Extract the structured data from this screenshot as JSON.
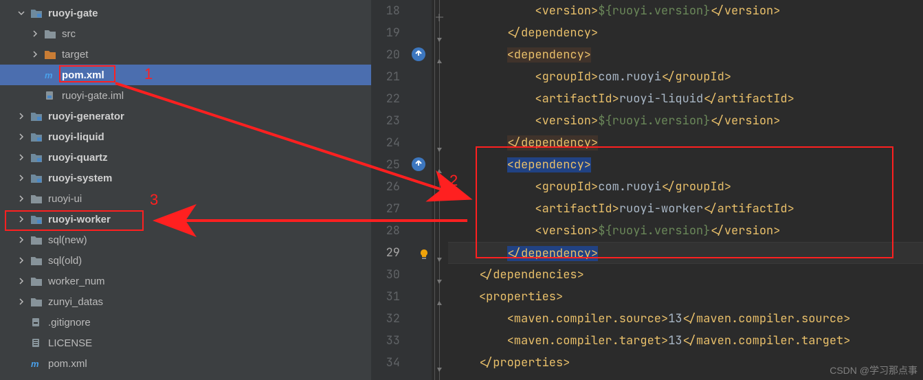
{
  "tree": {
    "ruoyi_gate": "ruoyi-gate",
    "src": "src",
    "target": "target",
    "pom_xml": "pom.xml",
    "gate_iml": "ruoyi-gate.iml",
    "ruoyi_generator": "ruoyi-generator",
    "ruoyi_liquid": "ruoyi-liquid",
    "ruoyi_quartz": "ruoyi-quartz",
    "ruoyi_system": "ruoyi-system",
    "ruoyi_ui": "ruoyi-ui",
    "ruoyi_worker": "ruoyi-worker",
    "sql_new": "sql(new)",
    "sql_old": "sql(old)",
    "worker_num": "worker_num",
    "zunyi_datas": "zunyi_datas",
    "gitignore": ".gitignore",
    "license": "LICENSE",
    "root_pom": "pom.xml"
  },
  "gutter": {
    "l18": "18",
    "l19": "19",
    "l20": "20",
    "l21": "21",
    "l22": "22",
    "l23": "23",
    "l24": "24",
    "l25": "25",
    "l26": "26",
    "l27": "27",
    "l28": "28",
    "l29": "29",
    "l30": "30",
    "l31": "31",
    "l32": "32",
    "l33": "33",
    "l34": "34"
  },
  "code": {
    "l18_partial_open": "<version>",
    "l18_partial_val": "${ruoyi.version}",
    "l18_partial_close": "</version>",
    "dep_close": "</dependency>",
    "dep_open": "<dependency>",
    "grp_open": "<groupId>",
    "grp_val": "com.ruoyi",
    "grp_close": "</groupId>",
    "art_open": "<artifactId>",
    "art_liquid": "ruoyi-liquid",
    "art_worker": "ruoyi-worker",
    "art_close": "</artifactId>",
    "ver_open": "<version>",
    "ver_val": "${ruoyi.version}",
    "ver_close": "</version>",
    "deps_close": "</dependencies>",
    "props_open": "<properties>",
    "mcs_open": "<maven.compiler.source>",
    "mcs_val": "13",
    "mcs_close": "</maven.compiler.source>",
    "mct_open": "<maven.compiler.target>",
    "mct_val": "13",
    "mct_close": "</maven.compiler.target>",
    "props_close": "</properties>"
  },
  "annotations": {
    "a1": "1",
    "a2": "2",
    "a3": "3"
  },
  "watermark": "CSDN @学习那点事",
  "chart_data": {
    "type": "table",
    "title": "pom.xml (ruoyi-gate)",
    "lines": [
      {
        "n": 18,
        "text": "            <version>${ruoyi.version}</version>"
      },
      {
        "n": 19,
        "text": "        </dependency>"
      },
      {
        "n": 20,
        "text": "        <dependency>"
      },
      {
        "n": 21,
        "text": "            <groupId>com.ruoyi</groupId>"
      },
      {
        "n": 22,
        "text": "            <artifactId>ruoyi-liquid</artifactId>"
      },
      {
        "n": 23,
        "text": "            <version>${ruoyi.version}</version>"
      },
      {
        "n": 24,
        "text": "        </dependency>"
      },
      {
        "n": 25,
        "text": "        <dependency>"
      },
      {
        "n": 26,
        "text": "            <groupId>com.ruoyi</groupId>"
      },
      {
        "n": 27,
        "text": "            <artifactId>ruoyi-worker</artifactId>"
      },
      {
        "n": 28,
        "text": "            <version>${ruoyi.version}</version>"
      },
      {
        "n": 29,
        "text": "        </dependency>"
      },
      {
        "n": 30,
        "text": "    </dependencies>"
      },
      {
        "n": 31,
        "text": "    <properties>"
      },
      {
        "n": 32,
        "text": "        <maven.compiler.source>13</maven.compiler.source>"
      },
      {
        "n": 33,
        "text": "        <maven.compiler.target>13</maven.compiler.target>"
      },
      {
        "n": 34,
        "text": "    </properties>"
      }
    ]
  }
}
